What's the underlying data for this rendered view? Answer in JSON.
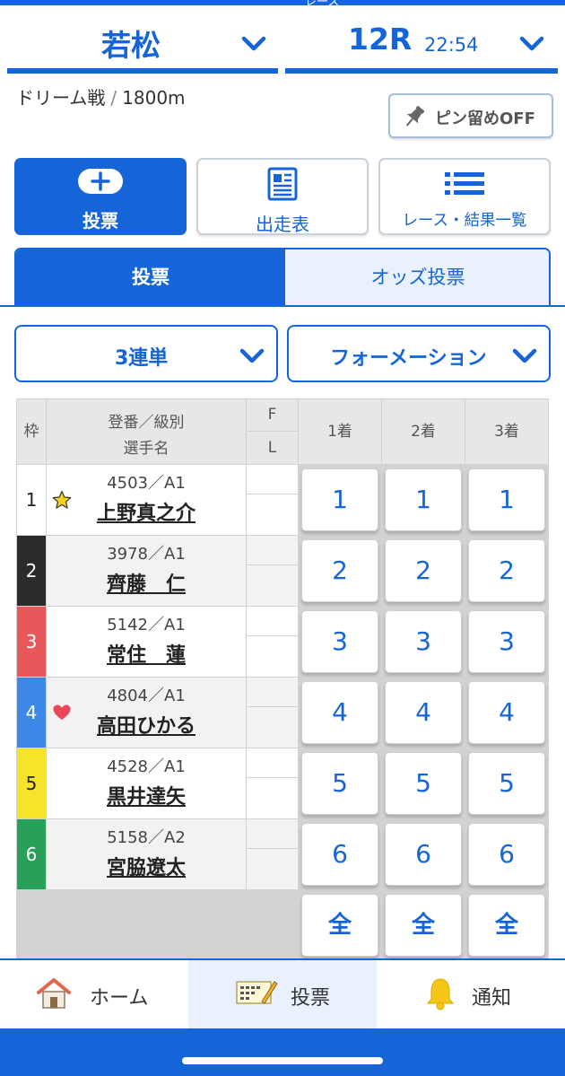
{
  "header": {
    "partial_title": "レース",
    "venue": "若松",
    "race_number": "12R",
    "race_time": "22:54",
    "race_name": "ドリーム戦",
    "distance": "1800m",
    "separator": "/",
    "pin_label": "ピン留めOFF"
  },
  "nav_buttons": {
    "vote": "投票",
    "entry_list": "出走表",
    "results": "レース・結果一覧"
  },
  "tabs": {
    "vote": "投票",
    "odds_vote": "オッズ投票"
  },
  "dropdowns": {
    "bet_type": "3連単",
    "bet_method": "フォーメーション"
  },
  "table": {
    "headers": {
      "waku": "枠",
      "reg_line1": "登番／級別",
      "reg_line2": "選手名",
      "f": "F",
      "l": "L",
      "place1": "1着",
      "place2": "2着",
      "place3": "3着"
    },
    "rows": [
      {
        "waku": "1",
        "reg": "4503／A1",
        "name": "上野真之介",
        "mark": "star",
        "color": "#ffffff",
        "text_color": "#222222"
      },
      {
        "waku": "2",
        "reg": "3978／A1",
        "name": "齊藤　仁",
        "mark": "",
        "color": "#2b2b2b",
        "text_color": "#ffffff"
      },
      {
        "waku": "3",
        "reg": "5142／A1",
        "name": "常住　蓮",
        "mark": "",
        "color": "#e8585a",
        "text_color": "#ffffff"
      },
      {
        "waku": "4",
        "reg": "4804／A1",
        "name": "高田ひかる",
        "mark": "heart",
        "color": "#3d88e6",
        "text_color": "#ffffff"
      },
      {
        "waku": "5",
        "reg": "4528／A1",
        "name": "黒井達矢",
        "mark": "",
        "color": "#f5e42a",
        "text_color": "#222222"
      },
      {
        "waku": "6",
        "reg": "5158／A2",
        "name": "宮脇遼太",
        "mark": "",
        "color": "#27a05a",
        "text_color": "#ffffff"
      }
    ],
    "all_label": "全"
  },
  "bottom_nav": {
    "home": "ホーム",
    "vote": "投票",
    "notify": "通知"
  },
  "colors": {
    "accent": "#1565d8",
    "light_accent": "#e8f1fd"
  }
}
